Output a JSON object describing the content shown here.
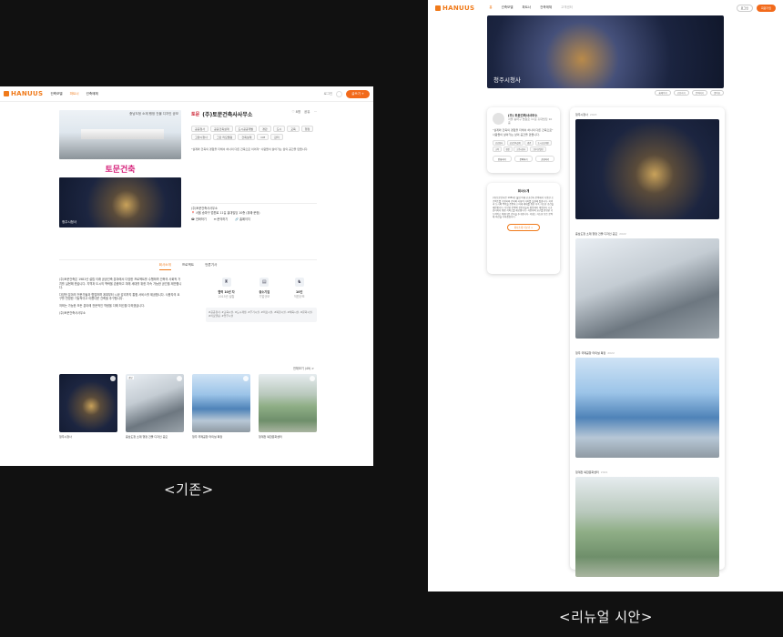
{
  "captions": {
    "left": "<기존>",
    "right": "<리뉴얼 시안>"
  },
  "left": {
    "nav": {
      "logo": "HANUUS",
      "menu": [
        "건축모델",
        "파트너",
        "건축매체"
      ],
      "login": "로그인",
      "cta": "글쓰기 +"
    },
    "hero": {
      "logo_text": "토문건축",
      "photo_caption": "청주시청사",
      "top_caption": "충남도청 소재 행정 건물 디자인 공모"
    },
    "office": {
      "mini_logo": "토문",
      "name": "(주)토문건축사사무소",
      "like": "♡ 8명",
      "share": "공유",
      "more": "⋯",
      "chips": [
        "공공청사",
        "공공건축설계",
        "도시공공개발",
        "경관",
        "도시",
        "교육",
        "행정",
        "고양시청사",
        "그린 리모델링",
        "건축설계",
        "CM",
        "감리"
      ],
      "desc": "\"설계와 건축의 경험을 더해서 하나의 다른 건축으로 이어져\" 사람들이 살아가는 삶의 공간을 만듭니다.",
      "contact_name": "(주)토문건축사사무소",
      "address": "📍 서울 송파구 법원로 11길 홍대빌딩 10층 (위례·문정)",
      "buttons": [
        "☎ 전화하기",
        "✉ 문의하기",
        "🔗 홈페이지"
      ]
    },
    "tabs": [
      "회사소개",
      "프로젝트",
      "언론기사"
    ],
    "intro": [
      "(주)토문건축은 1981년 설립 이래 공공건축 분야에서 다양한 프로젝트를 수행하며 건축의 사회적 가치를 실현해 왔습니다. 지역과 도시의 맥락을 존중하고 미래 세대를 위한 지속 가능한 공간을 제안합니다.",
      "다양한 분야의 전문가들과 협업하며 계획부터 시공 감리까지 통합 서비스를 제공합니다. 사용자의 요구를 반영한 기능적이고 아름다운 건축을 추구합니다.",
      "저희는 가능한 모든 분야에 전문적인 역량을 다해 최선을 다하겠습니다.",
      "(주)토문건축사사무소"
    ],
    "stats": [
      {
        "icon": "♜",
        "value": "협력 10년 차",
        "sub": "2015년 설립"
      },
      {
        "icon": "▤",
        "value": "중소기업",
        "sub": "기업규모"
      },
      {
        "icon": "♞",
        "value": "10인",
        "sub": "직원규모"
      }
    ],
    "tags": "#공공청사, #교육시설, #도시재생, #주거시설, #의료시설, #복합시설, #체육시설, #문화시설, #리모델링, #업무시설",
    "more_link": "전체보기 (49) >",
    "cards": [
      {
        "name": "청주시청사",
        "badge": ""
      },
      {
        "name": "충남도청 소재 행정 건물 디자인 공모",
        "badge": "공모"
      },
      {
        "name": "청주 국제공항 터미널 확장",
        "badge": ""
      },
      {
        "name": "청계천 복합문화센터",
        "badge": ""
      }
    ]
  },
  "right": {
    "nav": {
      "logo": "HANUUS",
      "menu": [
        "홈",
        "건축모델",
        "파트너",
        "건축매체",
        "고객센터"
      ],
      "login": "로그인",
      "cta": "회원가입"
    },
    "hero_caption": "청주시청사",
    "pills": [
      "홈페이지",
      "공유하기",
      "문의하기",
      "좋아요"
    ],
    "profile": {
      "name": "(주) 토문건축사사무소",
      "address": "서울 송파구 법원로 11길 홍대빌딩 10층",
      "desc": "\"설계와 건축의 경험을 더해서 하나의 다른 건축으로\" 사람들이 살아가는 삶의 공간을 만듭니다.",
      "chips": [
        "공공청사",
        "공공건축설계",
        "경관",
        "도시공공개발",
        "교육",
        "행정",
        "고양시청사",
        "그린리모델링"
      ],
      "actions": [
        "전화하기",
        "문의하기",
        "공유하기"
      ]
    },
    "about": {
      "title": "회사소개",
      "body": "(주)토문건축은 1981년 설립 이래 공공건축 분야에서 다양한 프로젝트를 수행하며 건축의 사회적 가치를 실현해 왔습니다. 지역과 도시의 맥락을 존중하고 미래 세대를 위한 지속 가능한 공간을 제안합니다. 다양한 분야의 전문가들과 협업하며 계획부터 시공 감리까지 통합 서비스를 제공합니다. 사용자의 요구를 반영한 기능적이고 아름다운 건축을 추구합니다. 저희는 가능한 모든 분야에 최선을 다하겠습니다.",
      "more": "회사소개 더보기 >"
    },
    "projects": [
      {
        "title": "청주시청사",
        "year": "2023",
        "style": "img-night"
      },
      {
        "title": "충남도청 소재 행정 건물 디자인 공모",
        "year": "2022",
        "style": "img-glass"
      },
      {
        "title": "청주 국제공항 터미널 확장",
        "year": "2022",
        "style": "img-blue"
      },
      {
        "title": "청계천 복합문화센터",
        "year": "2021",
        "style": "img-aerial"
      }
    ]
  }
}
